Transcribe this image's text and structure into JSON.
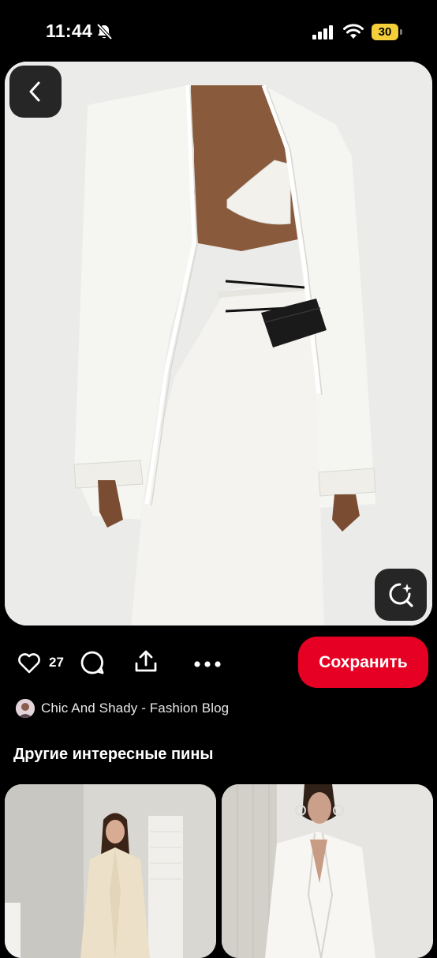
{
  "status_bar": {
    "time": "11:44",
    "battery_level": "30"
  },
  "pin": {
    "image_description_icon": "fashion-photo",
    "likes_count": "27",
    "save_label": "Сохранить"
  },
  "author": {
    "name": "Chic And Shady - Fashion Blog"
  },
  "more_pins": {
    "heading": "Другие интересные пины"
  },
  "colors": {
    "save_button": "#e60023",
    "battery": "#f4cf3a",
    "background": "#000000",
    "overlay_button": "#262626"
  }
}
